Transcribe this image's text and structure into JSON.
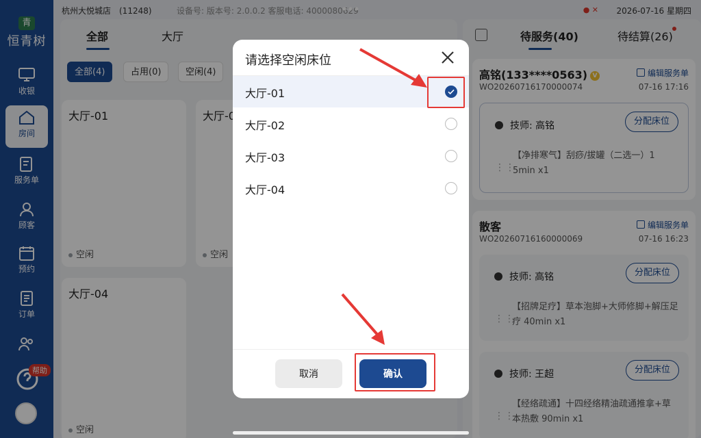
{
  "sidebar": {
    "logo_text": "恒青树",
    "logo_mark": "青",
    "items": [
      {
        "label": "收银",
        "icon": "cashier-icon"
      },
      {
        "label": "房间",
        "icon": "home-icon"
      },
      {
        "label": "服务单",
        "icon": "service-order-icon"
      },
      {
        "label": "顾客",
        "icon": "customer-icon"
      },
      {
        "label": "预约",
        "icon": "calendar-icon"
      },
      {
        "label": "订单",
        "icon": "order-icon"
      },
      {
        "label": "",
        "icon": "staff-icon"
      }
    ],
    "help_badge": "帮助"
  },
  "topbar": {
    "store": "杭州大悦城店　(11248)",
    "device": "设备号:  版本号:  2.0.0.2  客服电话: 4000080629",
    "datetime": "2026-07-16 星期四",
    "status": "● ✕"
  },
  "main": {
    "tabs": [
      "全部",
      "大厅"
    ],
    "filters": [
      "全部(4)",
      "占用(0)",
      "空闲(4)"
    ],
    "beds": [
      {
        "name": "大厅-01",
        "state": "空闲"
      },
      {
        "name": "大厅-02",
        "state": "空闲"
      },
      {
        "name": "大厅-04",
        "state": "空闲"
      }
    ]
  },
  "right": {
    "tabs": [
      "待服务(40)",
      "待结算(26)"
    ],
    "orders": [
      {
        "customer": "高铭(133****0563)",
        "vip": "V",
        "edit": "编辑服务单",
        "wo": "WO20260716170000074",
        "time": "07-16 17:16",
        "services": [
          {
            "tech": "技师:  高铭",
            "assign": "分配床位",
            "item": "【净排寒气】刮痧/拔罐（二选一）1 5min x1"
          }
        ]
      },
      {
        "customer": "散客",
        "edit": "编辑服务单",
        "wo": "WO20260716160000069",
        "time": "07-16 16:23",
        "services": [
          {
            "tech": "技师:  高铭",
            "assign": "分配床位",
            "item": "【招牌足疗】草本泡脚+大师修脚+解压足疗 40min x1"
          },
          {
            "tech": "技师:  王超",
            "assign": "分配床位",
            "item": "【经络疏通】十四经络精油疏通推拿+草本热敷 90min x1"
          }
        ]
      }
    ]
  },
  "modal": {
    "title": "请选择空闲床位",
    "options": [
      {
        "label": "大厅-01",
        "selected": true
      },
      {
        "label": "大厅-02",
        "selected": false
      },
      {
        "label": "大厅-03",
        "selected": false
      },
      {
        "label": "大厅-04",
        "selected": false
      }
    ],
    "cancel": "取消",
    "confirm": "确认"
  },
  "colors": {
    "primary": "#1d4a91",
    "annotation": "#e53935",
    "badge": "#d9362b"
  }
}
